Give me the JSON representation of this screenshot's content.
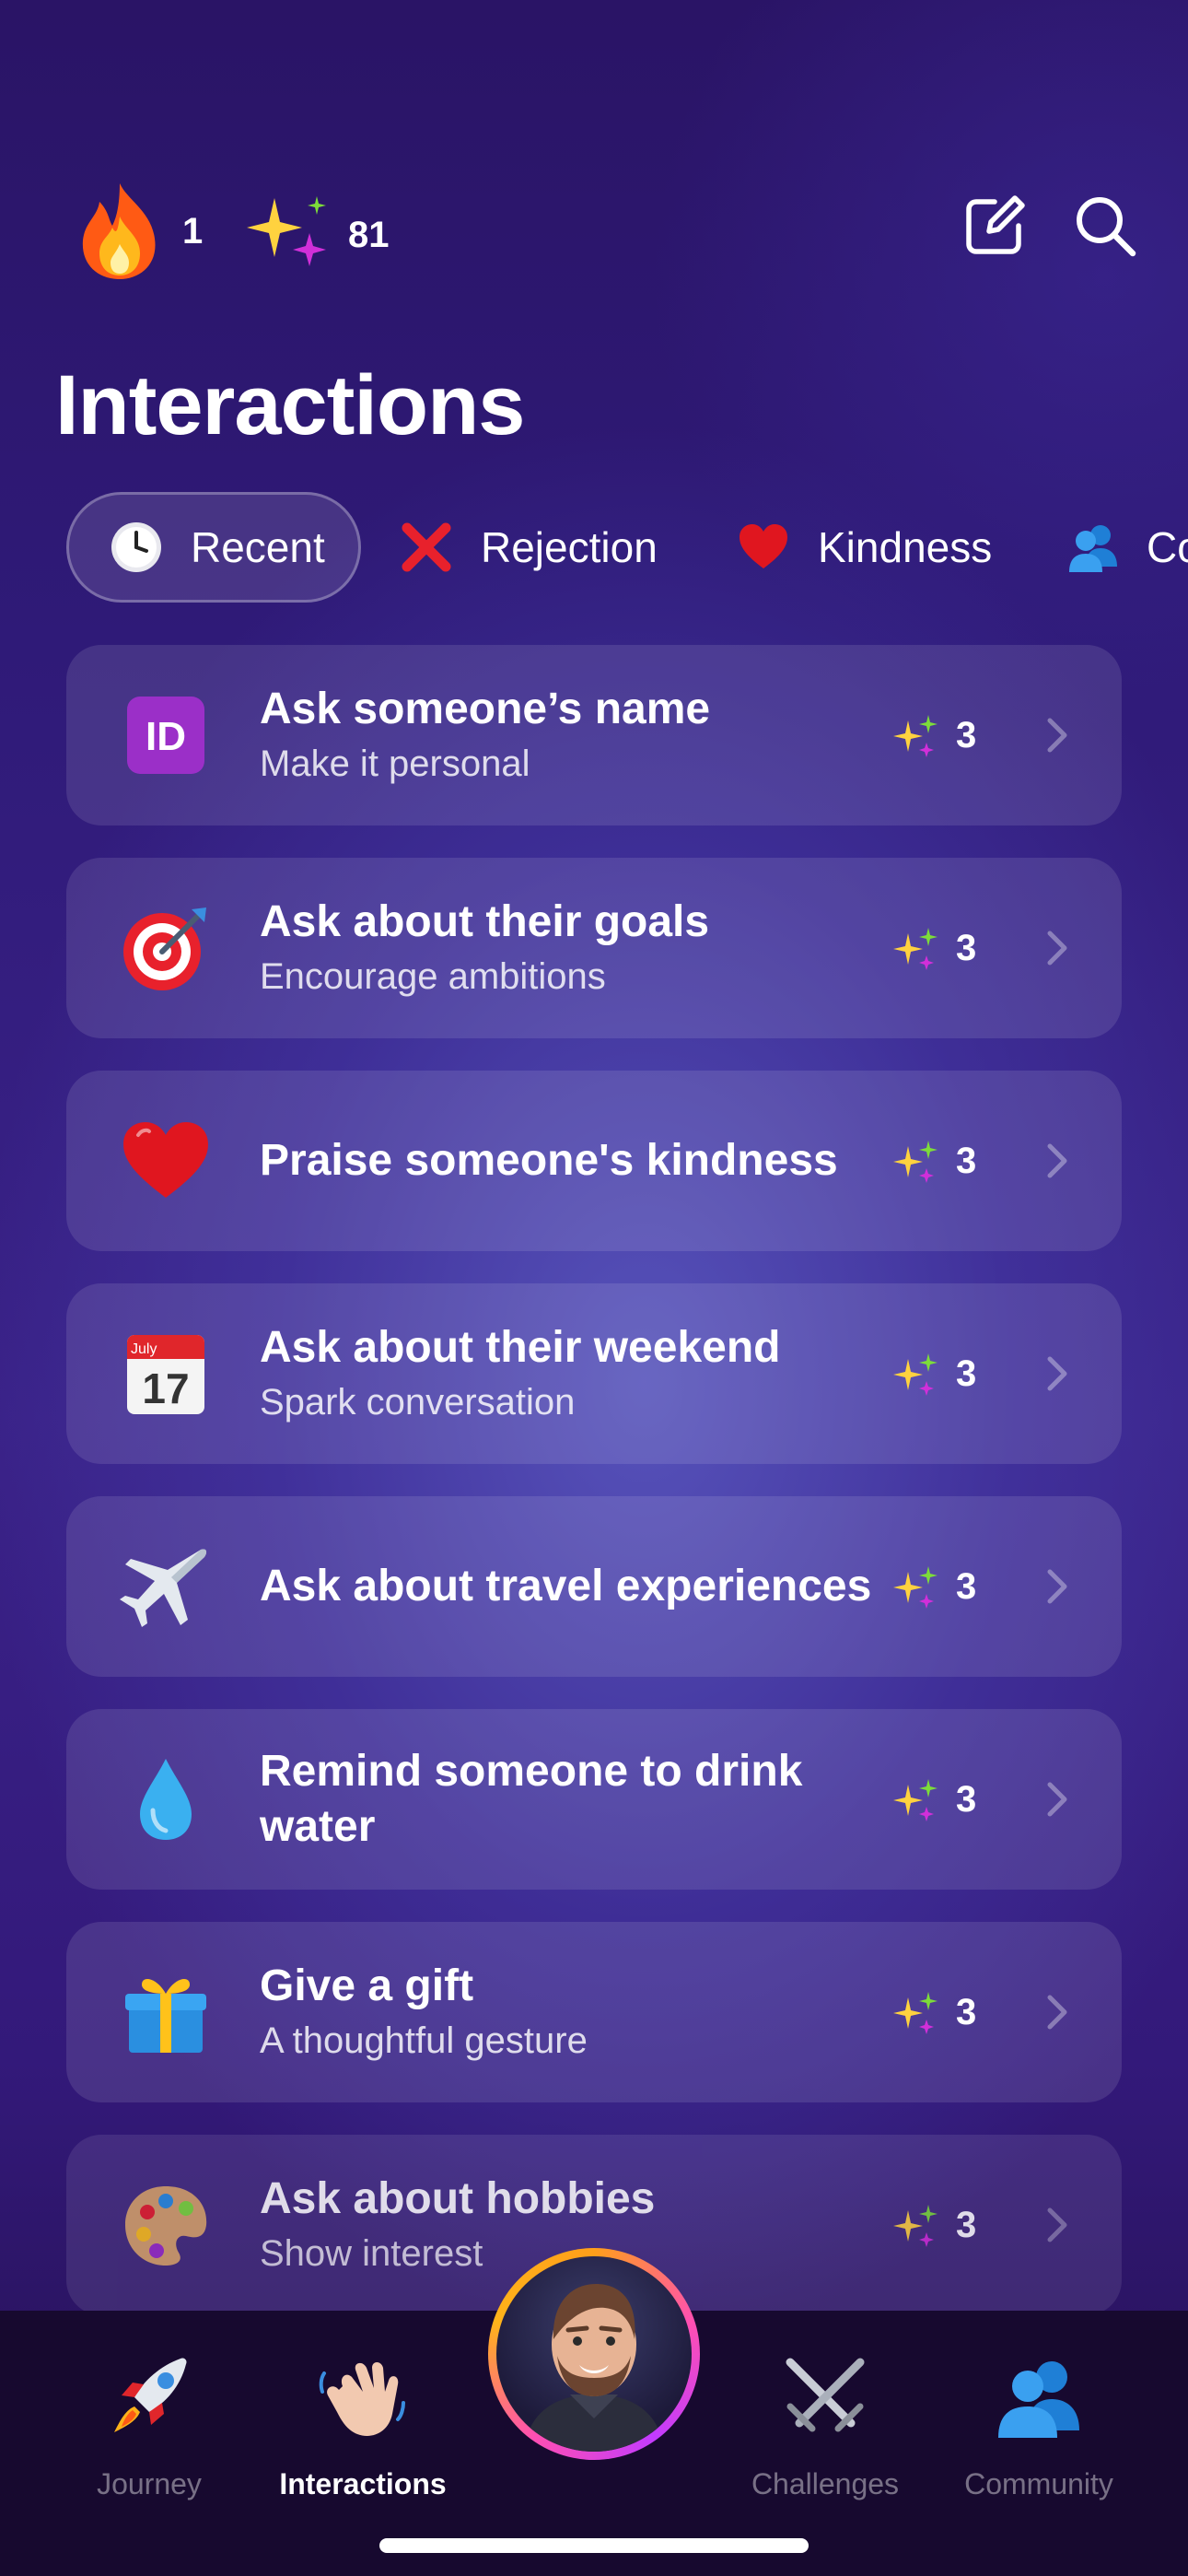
{
  "header": {
    "streak_count": "1",
    "points_count": "81"
  },
  "page_title": "Interactions",
  "filters": [
    {
      "label": "Recent",
      "icon": "clock-icon",
      "active": true
    },
    {
      "label": "Rejection",
      "icon": "cross-mark-icon",
      "active": false
    },
    {
      "label": "Kindness",
      "icon": "heart-icon",
      "active": false
    },
    {
      "label": "Co",
      "icon": "people-icon",
      "active": false
    }
  ],
  "items": [
    {
      "title": "Ask someone’s name",
      "subtitle": "Make it personal",
      "icon": "id-badge-icon",
      "reward": "3"
    },
    {
      "title": "Ask about their goals",
      "subtitle": "Encourage ambitions",
      "icon": "target-icon",
      "reward": "3"
    },
    {
      "title": "Praise someone's kindness",
      "subtitle": "",
      "icon": "heart-icon",
      "reward": "3"
    },
    {
      "title": "Ask about their weekend",
      "subtitle": "Spark conversation",
      "icon": "calendar-icon",
      "reward": "3",
      "calendar_month": "July",
      "calendar_day": "17"
    },
    {
      "title": "Ask about travel experiences",
      "subtitle": "",
      "icon": "airplane-icon",
      "reward": "3"
    },
    {
      "title": "Remind someone to drink water",
      "subtitle": "",
      "icon": "droplet-icon",
      "reward": "3"
    },
    {
      "title": "Give a gift",
      "subtitle": "A thoughtful gesture",
      "icon": "gift-icon",
      "reward": "3"
    },
    {
      "title": "Ask about hobbies",
      "subtitle": "Show interest",
      "icon": "palette-icon",
      "reward": "3"
    }
  ],
  "nav": {
    "journey": "Journey",
    "interactions": "Interactions",
    "challenges": "Challenges",
    "community": "Community"
  },
  "colors": {
    "background": "#2f1a78",
    "nav_background": "#17092f",
    "sparkle_gold": "#ffd23f",
    "sparkle_green": "#7ddc3a",
    "sparkle_magenta": "#d12fd9",
    "avatar_ring": "#ff9f1a"
  }
}
